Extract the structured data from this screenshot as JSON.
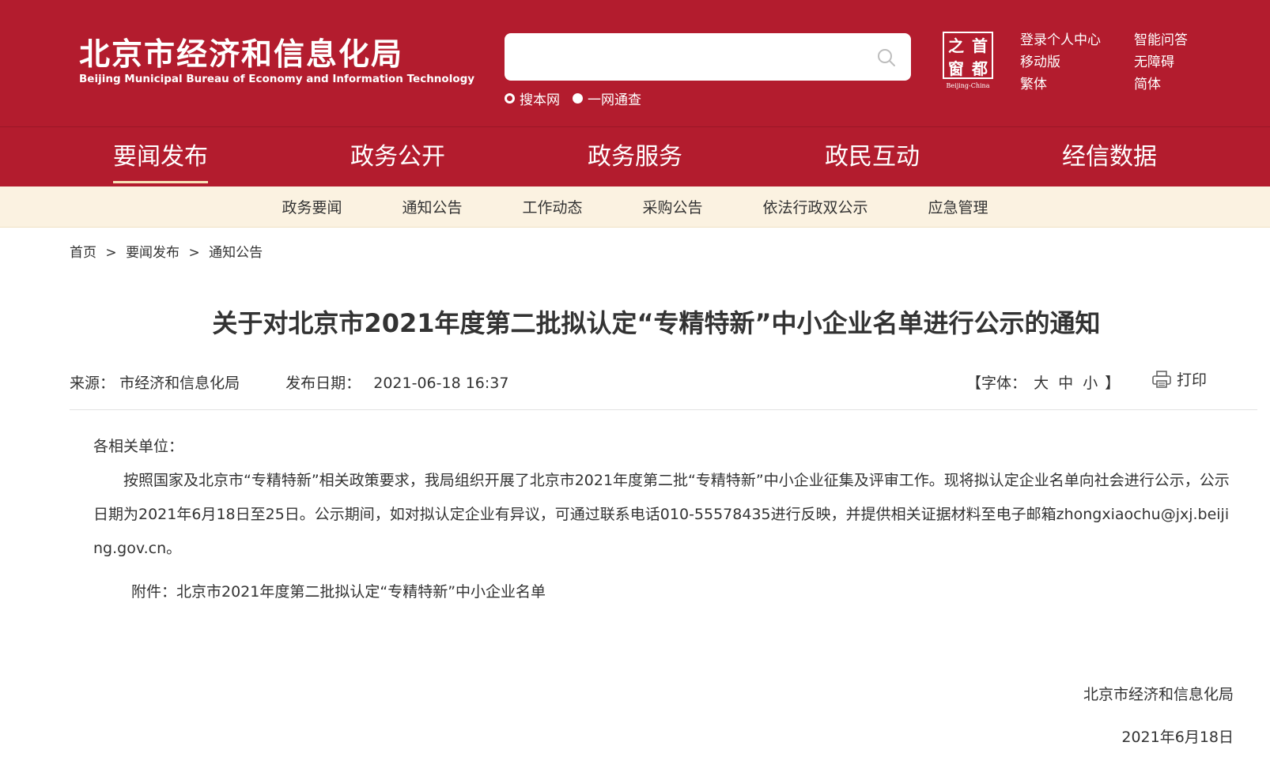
{
  "header": {
    "site_title": "北京市经济和信息化局",
    "site_subtitle": "Beijing Municipal Bureau of Economy and Information Technology",
    "search": {
      "placeholder": "",
      "options": [
        {
          "label": "搜本网",
          "selected": true
        },
        {
          "label": "一网通查",
          "selected": false
        }
      ]
    },
    "capital_logo": {
      "chars": [
        "之",
        "首",
        "窗",
        "都"
      ],
      "caption": "Beijing-China"
    },
    "links": [
      "登录个人中心",
      "智能问答",
      "移动版",
      "无障碍",
      "繁体",
      "简体"
    ]
  },
  "main_nav": {
    "items": [
      "要闻发布",
      "政务公开",
      "政务服务",
      "政民互动",
      "经信数据"
    ],
    "active_index": 0
  },
  "sub_nav": {
    "items": [
      "政务要闻",
      "通知公告",
      "工作动态",
      "采购公告",
      "依法行政双公示",
      "应急管理"
    ]
  },
  "breadcrumb": {
    "items": [
      "首页",
      "要闻发布",
      "通知公告"
    ],
    "separator": ">"
  },
  "article": {
    "title": "关于对北京市2021年度第二批拟认定“专精特新”中小企业名单进行公示的通知",
    "source_label": "来源：",
    "source_value": "市经济和信息化局",
    "date_label": "发布日期：",
    "date_value": "2021-06-18 16:37",
    "font_ctrl": {
      "prefix": "【字体：",
      "large": "大",
      "medium": "中",
      "small": "小",
      "suffix": "】"
    },
    "print_label": "打印",
    "salutation": "各相关单位：",
    "body": "按照国家及北京市“专精特新”相关政策要求，我局组织开展了北京市2021年度第二批“专精特新”中小企业征集及评审工作。现将拟认定企业名单向社会进行公示，公示日期为2021年6月18日至25日。公示期间，如对拟认定企业有异议，可通过联系电话010-55578435进行反映，并提供相关证据材料至电子邮箱zhongxiaochu@jxj.beijing.gov.cn。",
    "attachment": "附件：北京市2021年度第二批拟认定“专精特新”中小企业名单",
    "signature": "北京市经济和信息化局",
    "sign_date": "2021年6月18日"
  },
  "colors": {
    "header_red": "#b31c2e",
    "subnav_bg": "#fbf2e1",
    "active_underline": "#f6e3b8"
  }
}
